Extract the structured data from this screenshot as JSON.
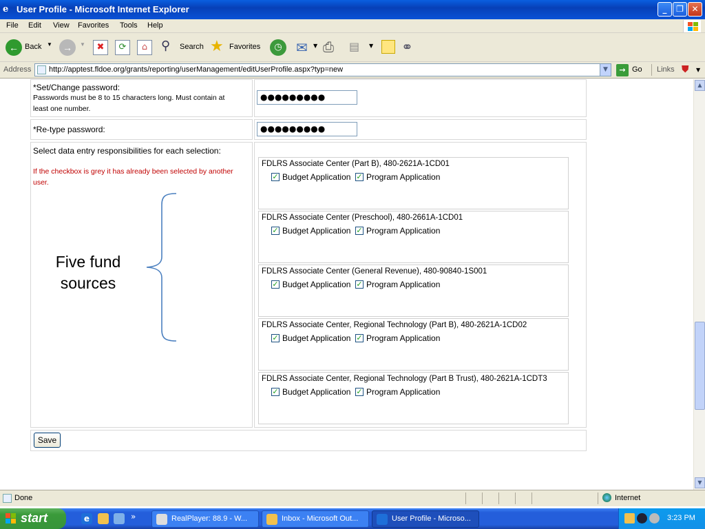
{
  "window": {
    "title": "User Profile - Microsoft Internet Explorer"
  },
  "menu": [
    "File",
    "Edit",
    "View",
    "Favorites",
    "Tools",
    "Help"
  ],
  "toolbar": {
    "back": "Back",
    "search": "Search",
    "favorites": "Favorites"
  },
  "address": {
    "label": "Address",
    "url": "http://apptest.fldoe.org/grants/reporting/userManagement/editUserProfile.aspx?typ=new",
    "go": "Go",
    "links": "Links"
  },
  "form": {
    "password_label": "*Set/Change password:",
    "password_hint_1": "Passwords must be 8 to 15 characters long. Must contain at",
    "password_hint_2": "least one number.",
    "password_value": "●●●●●●●●●",
    "retype_label": "*Re-type password:",
    "retype_value": "●●●●●●●●●",
    "select_label": "Select data entry responsibilities for each selection:",
    "grey_note_1": "If the checkbox is grey it has already been selected by another",
    "grey_note_2": "user.",
    "annotation_line1": "Five fund",
    "annotation_line2": "sources",
    "save_label": "Save",
    "budget_label": "Budget Application",
    "program_label": "Program Application",
    "funds": [
      {
        "name": "FDLRS Associate Center (Part B), 480-2621A-1CD01",
        "budget": true,
        "program": true
      },
      {
        "name": "FDLRS Associate Center (Preschool), 480-2661A-1CD01",
        "budget": true,
        "program": true
      },
      {
        "name": "FDLRS Associate Center (General Revenue), 480-90840-1S001",
        "budget": true,
        "program": true
      },
      {
        "name": "FDLRS Associate Center, Regional Technology (Part B), 480-2621A-1CD02",
        "budget": true,
        "program": true
      },
      {
        "name": "FDLRS Associate Center, Regional Technology (Part B Trust), 480-2621A-1CDT3",
        "budget": true,
        "program": true
      }
    ]
  },
  "status": {
    "text": "Done",
    "zone": "Internet"
  },
  "taskbar": {
    "start": "start",
    "tasks": [
      "RealPlayer: 88.9 - W...",
      "Inbox - Microsoft Out...",
      "User Profile - Microso..."
    ],
    "clock": "3:23 PM"
  }
}
